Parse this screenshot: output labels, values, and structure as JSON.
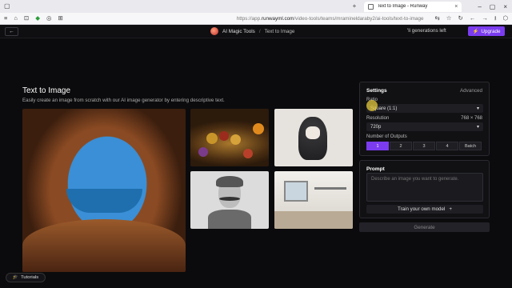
{
  "browser": {
    "tab_title": "Text to Image - Runway",
    "url_prefix": "https://app.",
    "url_domain": "runwayml.com",
    "url_path": "/video-tools/teams/mramineldaraby2/ai-tools/text-to-image",
    "icons": [
      "back-icon",
      "reload-icon",
      "home-icon",
      "extension-icon",
      "bookmark-icon",
      "shopping-icon",
      "plus-icon",
      "minimize-icon",
      "maximize-icon",
      "close-icon"
    ]
  },
  "header": {
    "back_label": "←",
    "app_name": "AI Magic Tools",
    "separator": "/",
    "current": "Text to Image",
    "generations": "'li generations left",
    "upgrade_label": "Upgrade"
  },
  "main": {
    "title": "Text to Image",
    "description": "Easily create an image from scratch with our AI image generator by entering descriptive text."
  },
  "settings": {
    "title": "Settings",
    "advanced_label": "Advanced",
    "ratio_label": "Ratio",
    "ratio_value": "Square (1:1)",
    "resolution_label": "Resolution",
    "resolution_dims": "768 × 768",
    "resolution_value": "720p",
    "outputs_label": "Number of Outputs",
    "outputs": [
      "1",
      "2",
      "3",
      "4",
      "Batch"
    ],
    "outputs_selected": "1"
  },
  "prompt": {
    "title": "Prompt",
    "placeholder": "Describe an image you want to generate.",
    "train_label": "Train your own model",
    "train_icon": "+"
  },
  "generate_label": "Generate",
  "tutorials_label": "Tutorials",
  "colors": {
    "accent": "#7b3cf0",
    "background": "#0b0b0d",
    "panel": "#111114"
  }
}
